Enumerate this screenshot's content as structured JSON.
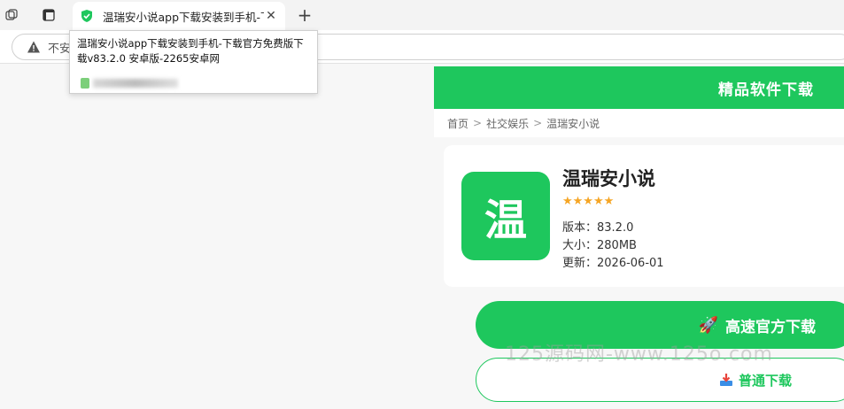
{
  "browser": {
    "tab": {
      "title": "温瑞安小说app下载安装到手机-下",
      "close_glyph": "✕"
    },
    "new_tab_glyph": "+",
    "address": {
      "security_text": "不安"
    },
    "tooltip": {
      "text": "温瑞安小说app下载安装到手机-下载官方免费版下载v83.2.0 安卓版-2265安卓网"
    }
  },
  "page": {
    "header_title": "精品软件下载",
    "breadcrumb": {
      "home": "首页",
      "category": "社交娱乐",
      "current": "温瑞安小说",
      "separator": ">"
    },
    "app": {
      "icon_char": "温",
      "name": "温瑞安小说",
      "stars": "★★★★★",
      "version": "版本：83.2.0",
      "size": "大小：280MB",
      "updated": "更新：2026-06-01"
    },
    "buttons": {
      "fast_download": "高速官方下载",
      "fast_icon": "🚀",
      "normal_download": "普通下载"
    }
  },
  "watermark": "125源码网-www.125o.com",
  "colors": {
    "brand_green": "#1ec75d",
    "star": "#f5a524"
  }
}
